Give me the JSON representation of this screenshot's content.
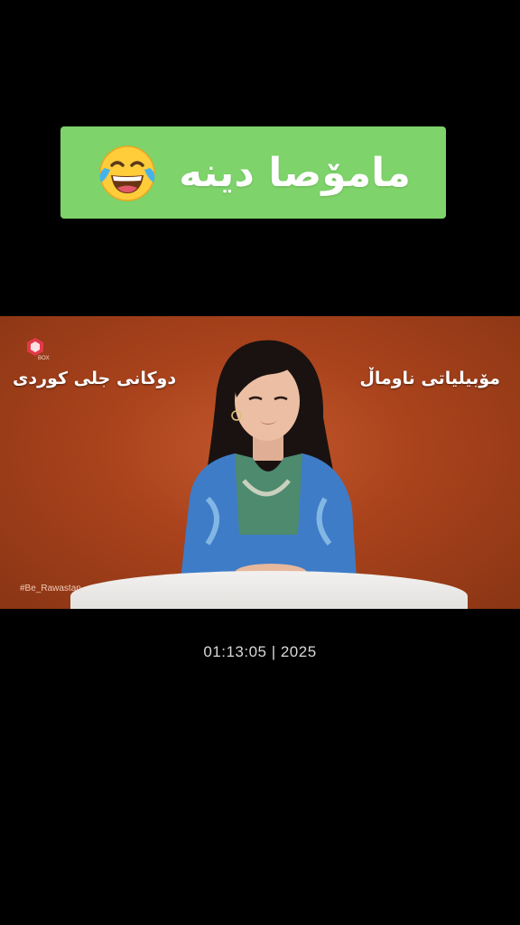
{
  "title_banner": {
    "text": "مامۆصا دینە",
    "emoji_icon": "face-with-tears-of-joy-icon",
    "background_color": "#7ed36a"
  },
  "video": {
    "logo_caption": "BOX",
    "overlay_left": "دوکانی جلی کوردی",
    "overlay_right": "مۆبیلیاتی ناوماڵ",
    "hashtag": "#Be_Rawastan"
  },
  "timestamp": "01:13:05 | 2025"
}
